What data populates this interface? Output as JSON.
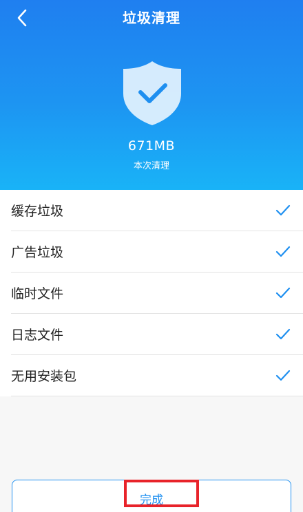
{
  "header": {
    "title": "垃圾清理",
    "back_icon": "chevron-left-icon",
    "shield_icon": "shield-check-icon"
  },
  "summary": {
    "size": "671MB",
    "label": "本次清理"
  },
  "items": [
    {
      "label": "缓存垃圾",
      "checked": true
    },
    {
      "label": "广告垃圾",
      "checked": true
    },
    {
      "label": "临时文件",
      "checked": true
    },
    {
      "label": "日志文件",
      "checked": true
    },
    {
      "label": "无用安装包",
      "checked": true
    }
  ],
  "footer": {
    "done_label": "完成"
  },
  "colors": {
    "accent": "#1e8ff0",
    "header_top": "#1f7ff0",
    "header_bottom": "#19b3f7",
    "highlight": "#e8232a"
  }
}
